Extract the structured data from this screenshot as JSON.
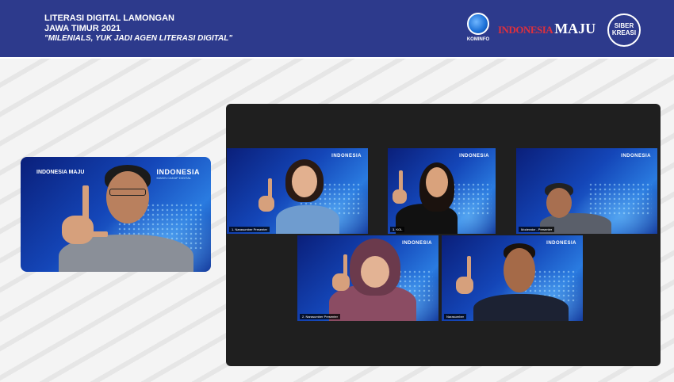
{
  "banner": {
    "title_line1": "LITERASI DIGITAL LAMONGAN",
    "title_line2": "JAWA TIMUR 2021",
    "tagline": "\"MILENIALS, YUK JADI AGEN LITERASI DIGITAL\"",
    "logos": {
      "kominfo": "KOMINFO",
      "indonesia": "INDONESIA",
      "maju": "MAJU",
      "siberkreasi_1": "SIBER",
      "siberkreasi_2": "KREASI"
    }
  },
  "speaker_tile": {
    "brand": "INDONESIA",
    "brand_sub": "MAKIN CAKAP DIGITAL",
    "logos_text": "INDONESIA MAJU"
  },
  "gallery": {
    "tiles": [
      {
        "brand": "INDONESIA",
        "name": "1. Narasumber Presenter"
      },
      {
        "brand": "INDONESIA",
        "name": "3. KOL"
      },
      {
        "brand": "INDONESIA",
        "name": "Moderator - Presenter"
      },
      {
        "brand": "INDONESIA",
        "name": "2. Narasumber Presenter"
      },
      {
        "brand": "INDONESIA",
        "name": "Narasumber"
      }
    ]
  },
  "colors": {
    "banner": "#2d3a8c",
    "gallery_bg": "#1f1f1f",
    "accent_red": "#e0303c"
  }
}
